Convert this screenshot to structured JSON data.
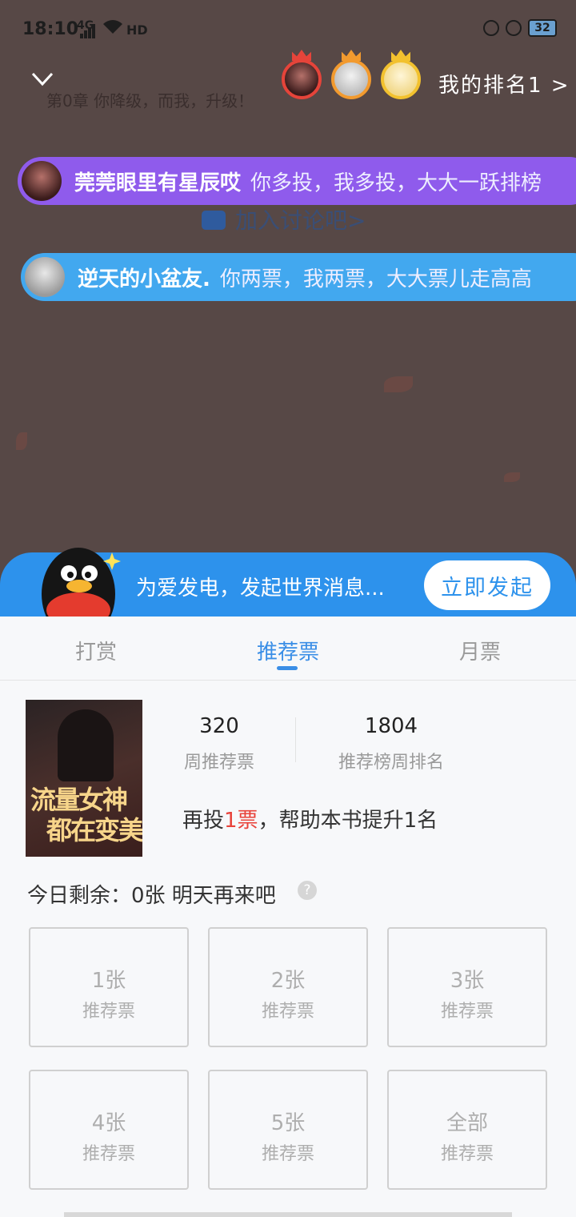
{
  "status_bar": {
    "time": "18:10",
    "network": "4G",
    "hd": "HD",
    "battery": "32"
  },
  "reader": {
    "chapter_title": "第0章 你降级，而我，升级！"
  },
  "ranking": {
    "my_rank_label": "我的排名1 >"
  },
  "danmaku": [
    {
      "user": "莞莞眼里有星辰哎",
      "message": "你多投，我多投，大大一跃排榜",
      "color": "#8f5bec"
    },
    {
      "user": "逆天的小盆友.",
      "message": "你两票，我两票，大大票儿走高高",
      "color": "#42a8ef"
    }
  ],
  "discussion": {
    "label": "加入讨论吧>"
  },
  "banner": {
    "text": "为爱发电，发起世界消息...",
    "button": "立即发起"
  },
  "tabs": [
    {
      "label": "打赏",
      "active": false
    },
    {
      "label": "推荐票",
      "active": true
    },
    {
      "label": "月票",
      "active": false
    }
  ],
  "book": {
    "cover_title_line1": "流量女神",
    "cover_title_line2": "都在变美",
    "weekly_votes": "320",
    "weekly_votes_label": "周推荐票",
    "weekly_rank": "1804",
    "weekly_rank_label": "推荐榜周排名",
    "hint_prefix": "再投",
    "hint_count": "1票",
    "hint_suffix": "，帮助本书提升1名"
  },
  "remaining": {
    "text": "今日剩余：0张 明天再来吧",
    "help_icon": "?"
  },
  "ticket_options": [
    {
      "amount": "1张",
      "unit": "推荐票"
    },
    {
      "amount": "2张",
      "unit": "推荐票"
    },
    {
      "amount": "3张",
      "unit": "推荐票"
    },
    {
      "amount": "4张",
      "unit": "推荐票"
    },
    {
      "amount": "5张",
      "unit": "推荐票"
    },
    {
      "amount": "全部",
      "unit": "推荐票"
    }
  ],
  "colors": {
    "accent": "#3a8ee6",
    "banner": "#2d92ec",
    "highlight": "#e8423a"
  }
}
